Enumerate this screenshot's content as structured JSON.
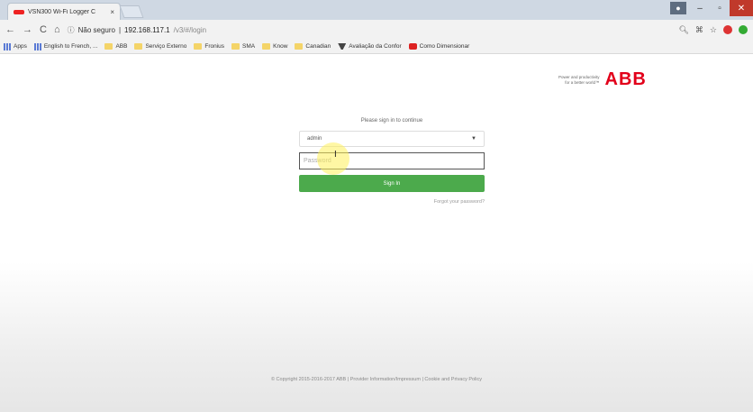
{
  "browser": {
    "tab_title": "VSN300 Wi-Fi Logger C",
    "tab_close": "×",
    "url_security": "Não seguro",
    "url_host": "192.168.117.1",
    "url_path": "/v3/#/login",
    "bookmarks": [
      {
        "label": "Apps",
        "icon": "apps-grid-icon"
      },
      {
        "label": "English to French, ...",
        "icon": "translate-icon"
      },
      {
        "label": "ABB",
        "icon": "folder-icon"
      },
      {
        "label": "Serviço Externo",
        "icon": "folder-icon"
      },
      {
        "label": "Fronius",
        "icon": "folder-icon"
      },
      {
        "label": "SMA",
        "icon": "folder-icon"
      },
      {
        "label": "Know",
        "icon": "folder-icon"
      },
      {
        "label": "Canadian",
        "icon": "folder-icon"
      },
      {
        "label": "Avaliação da Confor",
        "icon": "wt-icon"
      },
      {
        "label": "Como Dimensionar",
        "icon": "youtube-icon"
      }
    ]
  },
  "page": {
    "brand": {
      "tagline_line1": "Power and productivity",
      "tagline_line2": "for a better world™",
      "logo": "ABB"
    },
    "login": {
      "prompt": "Please sign in to continue",
      "username_selected": "admin",
      "password_placeholder": "Password",
      "signin_label": "Sign In",
      "forgot_label": "Forgot your password?"
    },
    "footer": "© Copyright 2015-2016-2017 ABB | Provider Information/Impressum | Cookie and Privacy Policy"
  },
  "colors": {
    "accent_green": "#4caa4c",
    "brand_red": "#e2001a"
  }
}
